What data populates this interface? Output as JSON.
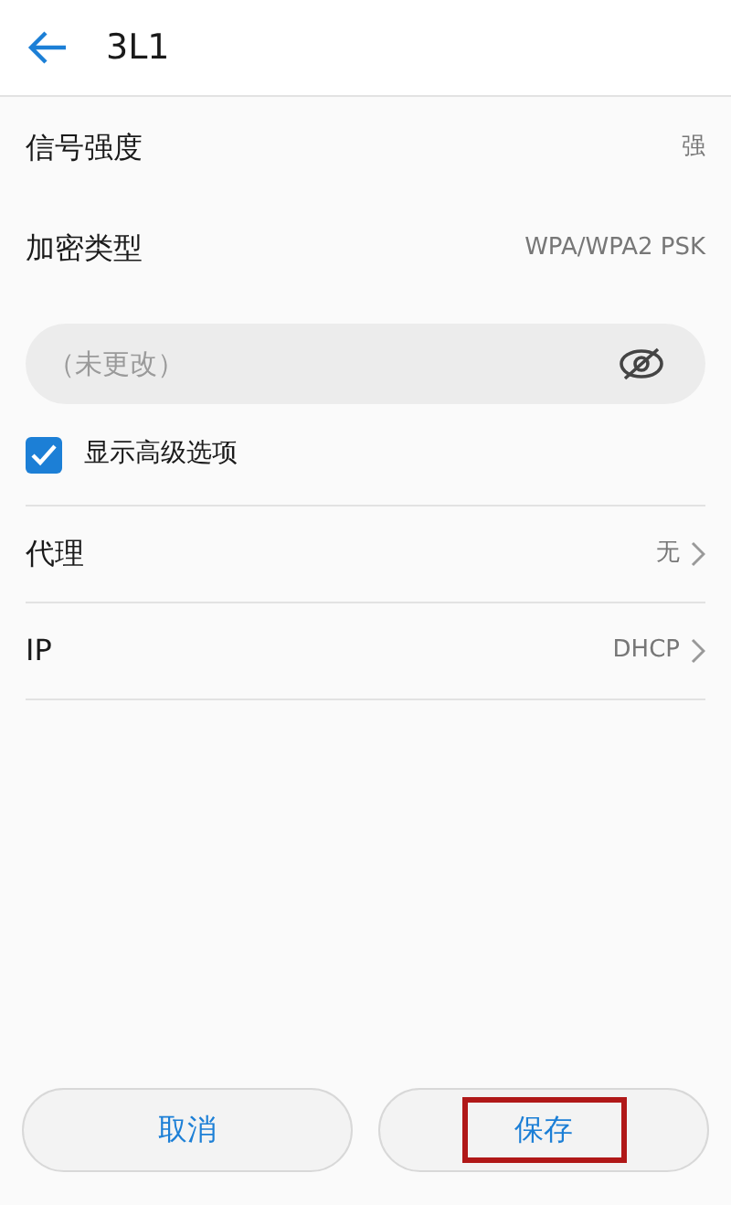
{
  "header": {
    "title": "3L1"
  },
  "info_rows": [
    {
      "label": "信号强度",
      "value": "强"
    },
    {
      "label": "加密类型",
      "value": "WPA/WPA2 PSK"
    }
  ],
  "password": {
    "placeholder": "（未更改）",
    "visible": false
  },
  "advanced": {
    "label": "显示高级选项",
    "checked": true
  },
  "settings": [
    {
      "label": "代理",
      "value": "无"
    },
    {
      "label": "IP",
      "value": "DHCP"
    }
  ],
  "buttons": [
    {
      "label": "取消",
      "highlighted": false
    },
    {
      "label": "保存",
      "highlighted": true
    }
  ]
}
